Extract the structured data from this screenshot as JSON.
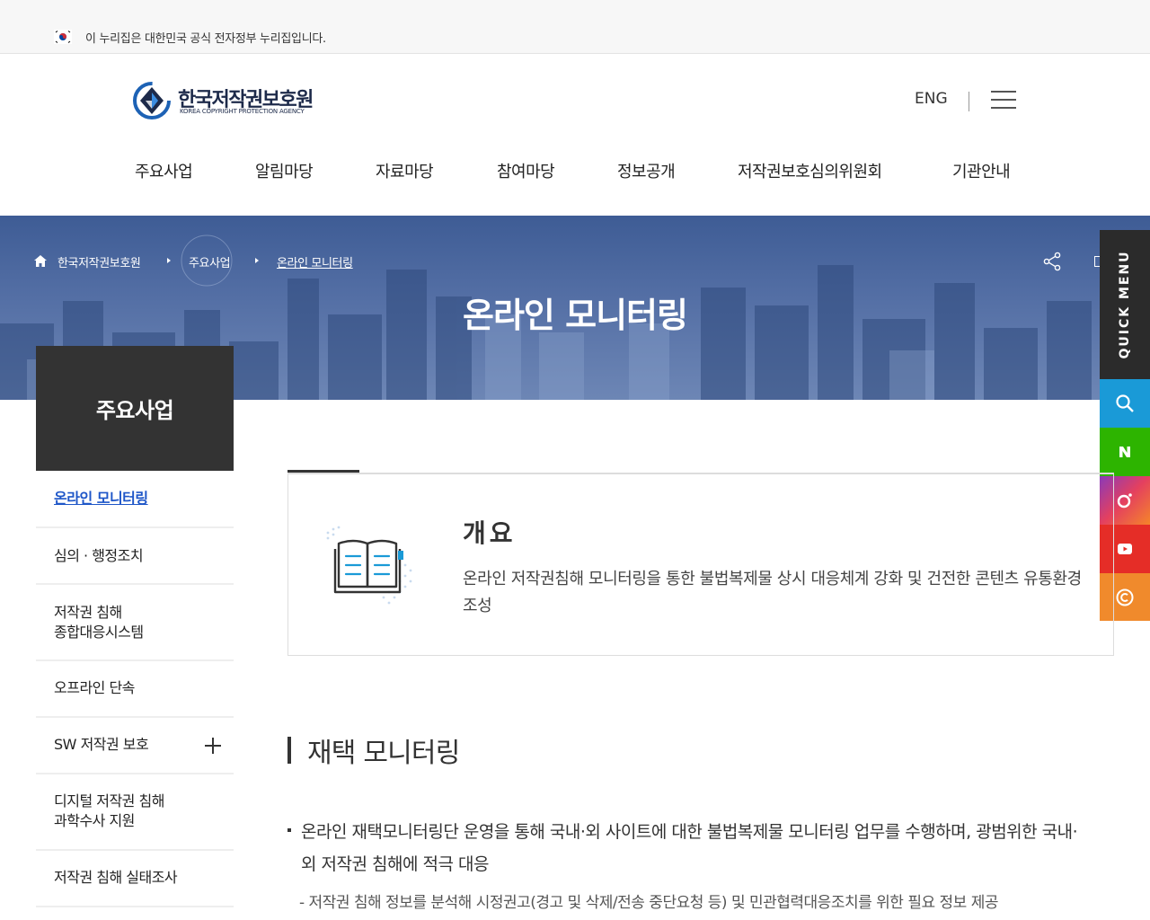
{
  "gov_banner": {
    "text": "이 누리집은 대한민국 공식 전자정부 누리집입니다."
  },
  "header": {
    "logo_name": "한국저작권보호원",
    "logo_sub": "KOREA COPYRIGHT PROTECTION AGENCY",
    "eng_label": "ENG",
    "nav": [
      "주요사업",
      "알림마당",
      "자료마당",
      "참여마당",
      "정보공개",
      "저작권보호심의위원회",
      "기관안내"
    ]
  },
  "hero": {
    "breadcrumb": [
      "한국저작권보호원",
      "주요사업",
      "온라인 모니터링"
    ],
    "title": "온라인 모니터링"
  },
  "quick_menu": {
    "label": "QUICK MENU",
    "buttons": [
      {
        "icon": "search-icon",
        "color": "#1a9ad7"
      },
      {
        "icon": "naver-icon",
        "color": "#2db400"
      },
      {
        "icon": "instagram-icon",
        "color": "#e4405f"
      },
      {
        "icon": "youtube-icon",
        "color": "#e52d27"
      },
      {
        "icon": "copyright-icon",
        "color": "#f08a2c"
      }
    ]
  },
  "side_nav": {
    "title": "주요사업",
    "items": [
      {
        "label": "온라인 모니터링",
        "active": true
      },
      {
        "label": "심의 · 행정조치"
      },
      {
        "label": "저작권 침해\n종합대응시스템"
      },
      {
        "label": "오프라인 단속"
      },
      {
        "label": "SW 저작권 보호",
        "expandable": true
      },
      {
        "label": "디지털 저작권 침해\n과학수사 지원"
      },
      {
        "label": "저작권 침해 실태조사"
      }
    ]
  },
  "overview": {
    "title": "개요",
    "desc": "온라인 저작권침해 모니터링을 통한 불법복제물 상시 대응체계 강화 및 건전한 콘텐츠 유통환경 조성"
  },
  "section": {
    "title": "재택 모니터링",
    "bullet": "온라인 재택모니터링단 운영을 통해 국내·외 사이트에 대한 불법복제물 모니터링 업무를 수행하며, 광범위한 국내·외 저작권 침해에 적극 대응",
    "sub": "- 저작권 침해 정보를 분석해 시정권고(경고 및 삭제/전송 중단요청 등) 및 민관협력대응조치를 위한 필요 정보 제공"
  },
  "colors": {
    "accent": "#1e56c8",
    "dark": "#333333",
    "hero": "#4a6aa0"
  }
}
